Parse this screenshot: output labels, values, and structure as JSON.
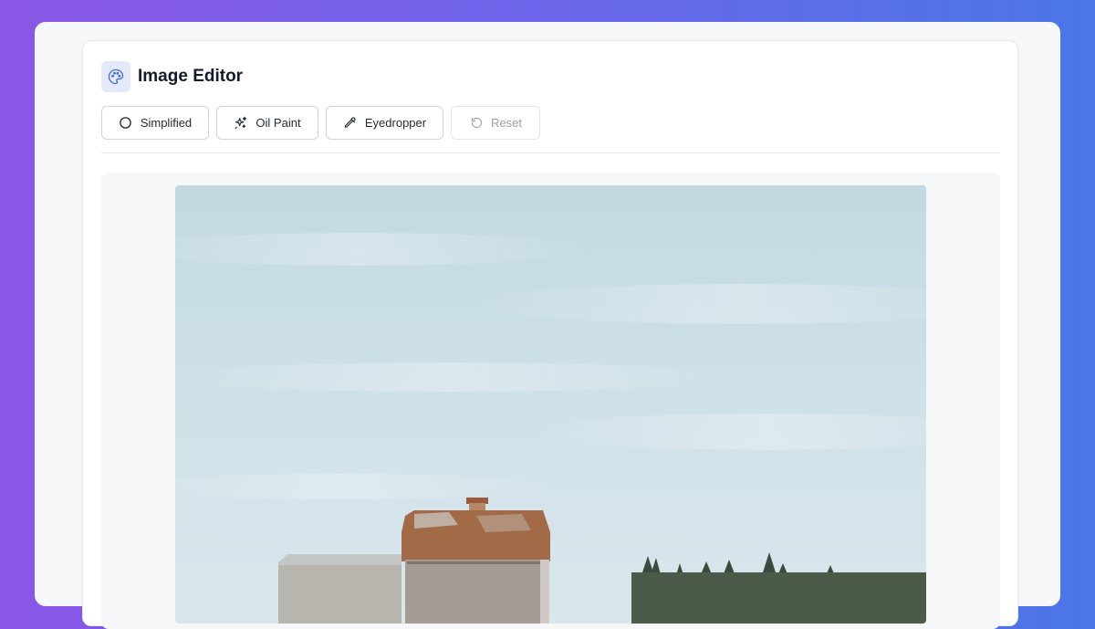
{
  "app": {
    "title": "Image Editor",
    "icon": "palette-icon",
    "accent": "#4b6bd6"
  },
  "toolbar": {
    "buttons": [
      {
        "label": "Simplified",
        "icon": "circle-icon",
        "enabled": true
      },
      {
        "label": "Oil Paint",
        "icon": "sparkles-icon",
        "enabled": true
      },
      {
        "label": "Eyedropper",
        "icon": "eyedropper-icon",
        "enabled": true
      },
      {
        "label": "Reset",
        "icon": "reset-icon",
        "enabled": false
      }
    ]
  },
  "canvas": {
    "image_subject": "barn-under-cloudy-sky"
  }
}
